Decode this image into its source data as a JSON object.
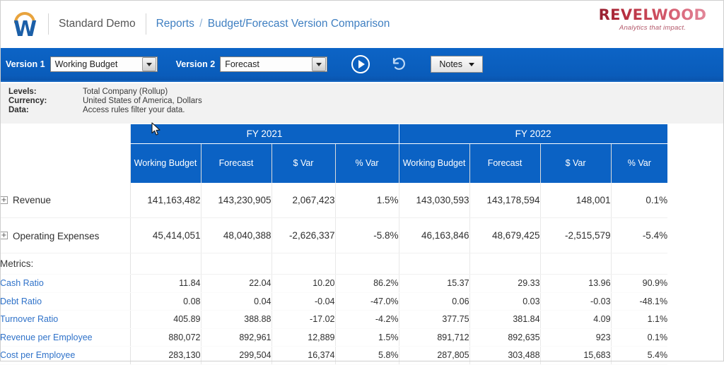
{
  "header": {
    "logo_icon": "workday-w-logo",
    "tenant": "Standard Demo",
    "breadcrumb_root": "Reports",
    "breadcrumb_sep": "/",
    "breadcrumb_page": "Budget/Forecast Version Comparison",
    "brand_name": "REVELWOOD",
    "brand_tagline": "Analytics that impact.",
    "brand_color": "#b32b3c"
  },
  "toolbar": {
    "version1_label": "Version 1",
    "version1_value": "Working Budget",
    "version2_label": "Version 2",
    "version2_value": "Forecast",
    "run_icon": "play-circle-icon",
    "reset_icon": "undo-arrow-icon",
    "notes_label": "Notes",
    "notes_caret_icon": "chevron-down-icon",
    "background_color": "#0b5fc0"
  },
  "info": {
    "rows": [
      {
        "key": "Levels:",
        "value": "Total Company (Rollup)"
      },
      {
        "key": "Currency:",
        "value": "United States of America, Dollars"
      },
      {
        "key": "Data:",
        "value": "Access rules filter your data."
      }
    ]
  },
  "table": {
    "year_groups": [
      "FY 2021",
      "FY 2022"
    ],
    "columns": [
      "Working Budget",
      "Forecast",
      "$ Var",
      "% Var"
    ],
    "header_color": "#0b62c4",
    "rows": [
      {
        "label": "Revenue",
        "expander_icon": "expand-plus-icon",
        "type": "account",
        "values": [
          "141,163,482",
          "143,230,905",
          "2,067,423",
          "1.5%",
          "143,030,593",
          "143,178,594",
          "148,001",
          "0.1%"
        ]
      },
      {
        "label": "Operating Expenses",
        "expander_icon": "expand-plus-icon",
        "type": "account",
        "values": [
          "45,414,051",
          "48,040,388",
          "-2,626,337",
          "-5.8%",
          "46,163,846",
          "48,679,425",
          "-2,515,579",
          "-5.4%"
        ]
      }
    ],
    "metrics_title": "Metrics:",
    "metrics": [
      {
        "label": "Cash Ratio",
        "values": [
          "11.84",
          "22.04",
          "10.20",
          "86.2%",
          "15.37",
          "29.33",
          "13.96",
          "90.9%"
        ]
      },
      {
        "label": "Debt Ratio",
        "values": [
          "0.08",
          "0.04",
          "-0.04",
          "-47.0%",
          "0.06",
          "0.03",
          "-0.03",
          "-48.1%"
        ]
      },
      {
        "label": "Turnover Ratio",
        "values": [
          "405.89",
          "388.88",
          "-17.02",
          "-4.2%",
          "377.75",
          "381.84",
          "4.09",
          "1.1%"
        ]
      },
      {
        "label": "Revenue per Employee",
        "values": [
          "880,072",
          "892,961",
          "12,889",
          "1.5%",
          "891,712",
          "892,635",
          "923",
          "0.1%"
        ]
      },
      {
        "label": "Cost per Employee",
        "values": [
          "283,130",
          "299,504",
          "16,374",
          "5.8%",
          "287,805",
          "303,488",
          "15,683",
          "5.4%"
        ]
      }
    ]
  },
  "pointer": {
    "icon": "mouse-cursor-arrow"
  }
}
